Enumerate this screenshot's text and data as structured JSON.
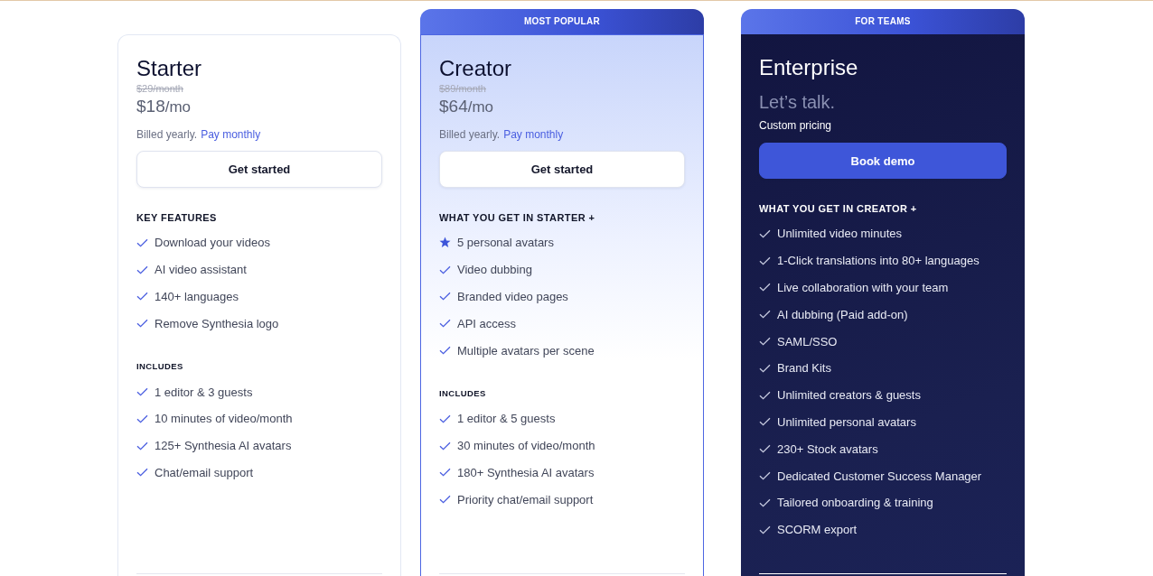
{
  "plans": [
    {
      "kind": "standard",
      "name": "Starter",
      "old_price": "$29/month",
      "price": "$18",
      "price_unit": "/mo",
      "note": "Billed yearly.",
      "note_link": "Pay monthly",
      "button": "Get started",
      "sections": [
        {
          "heading": "KEY FEATURES",
          "items": [
            {
              "kind": "check",
              "text": "Download your videos"
            },
            {
              "kind": "check",
              "text": "AI video assistant"
            },
            {
              "kind": "check",
              "text": "140+ languages"
            },
            {
              "kind": "check",
              "text": "Remove Synthesia logo"
            }
          ]
        },
        {
          "heading": "INCLUDES",
          "items": [
            {
              "kind": "check",
              "text": "1 editor & 3 guests"
            },
            {
              "kind": "check",
              "text": "10 minutes of video/month"
            },
            {
              "kind": "check",
              "text": "125+ Synthesia AI avatars"
            },
            {
              "kind": "check",
              "text": "Chat/email support"
            }
          ]
        }
      ]
    },
    {
      "kind": "featured",
      "banner": "MOST POPULAR",
      "name": "Creator",
      "old_price": "$89/month",
      "price": "$64",
      "price_unit": "/mo",
      "note": "Billed yearly.",
      "note_link": "Pay monthly",
      "button": "Get started",
      "sections": [
        {
          "heading": "WHAT YOU GET IN STARTER +",
          "items": [
            {
              "kind": "star",
              "text": "5 personal avatars"
            },
            {
              "kind": "check",
              "text": "Video dubbing"
            },
            {
              "kind": "check",
              "text": "Branded video pages"
            },
            {
              "kind": "check",
              "text": "API access"
            },
            {
              "kind": "check",
              "text": "Multiple avatars per scene"
            }
          ]
        },
        {
          "heading": "INCLUDES",
          "items": [
            {
              "kind": "check",
              "text": "1 editor & 5 guests"
            },
            {
              "kind": "check",
              "text": "30 minutes of video/month"
            },
            {
              "kind": "check",
              "text": "180+ Synthesia AI avatars"
            },
            {
              "kind": "check",
              "text": "Priority chat/email support"
            }
          ]
        }
      ]
    },
    {
      "kind": "dark",
      "banner": "FOR TEAMS",
      "name": "Enterprise",
      "price": "Let’s talk.",
      "note": "Custom pricing",
      "button": "Book demo",
      "sections": [
        {
          "heading": "WHAT YOU GET IN CREATOR +",
          "items": [
            {
              "kind": "check",
              "text": "Unlimited video minutes"
            },
            {
              "kind": "check",
              "text": "1-Click translations into 80+ languages"
            },
            {
              "kind": "check",
              "text": "Live collaboration with your team"
            },
            {
              "kind": "check",
              "text": "AI dubbing (Paid add-on)"
            },
            {
              "kind": "check",
              "text": "SAML/SSO"
            },
            {
              "kind": "check",
              "text": "Brand Kits"
            },
            {
              "kind": "check",
              "text": "Unlimited creators & guests"
            },
            {
              "kind": "check",
              "text": "Unlimited personal avatars"
            },
            {
              "kind": "check",
              "text": "230+ Stock avatars"
            },
            {
              "kind": "check",
              "text": "Dedicated Customer Success Manager"
            },
            {
              "kind": "check",
              "text": "Tailored onboarding & training"
            },
            {
              "kind": "check",
              "text": "SCORM export"
            }
          ]
        }
      ]
    }
  ]
}
